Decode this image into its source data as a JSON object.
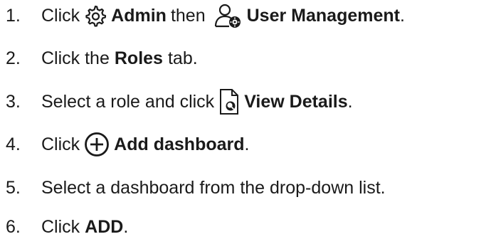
{
  "steps": [
    {
      "number": "1.",
      "click": "Click",
      "admin_icon": "gear-icon",
      "admin": "Admin",
      "then": "then",
      "user_mgmt_icon": "user-settings-icon",
      "user_mgmt": "User Management",
      "end": "."
    },
    {
      "number": "2.",
      "pre": "Click the",
      "roles": "Roles",
      "post": "tab."
    },
    {
      "number": "3.",
      "pre": "Select a role and click",
      "view_icon": "document-search-icon",
      "view": "View Details",
      "end": "."
    },
    {
      "number": "4.",
      "pre": "Click",
      "add_icon": "circle-plus-icon",
      "add": "Add dashboard",
      "end": "."
    },
    {
      "number": "5.",
      "text": "Select a dashboard from the drop-down list."
    },
    {
      "number": "6.",
      "pre": "Click",
      "add": "ADD",
      "end": "."
    }
  ],
  "colors": {
    "text": "#1a1a1a"
  }
}
